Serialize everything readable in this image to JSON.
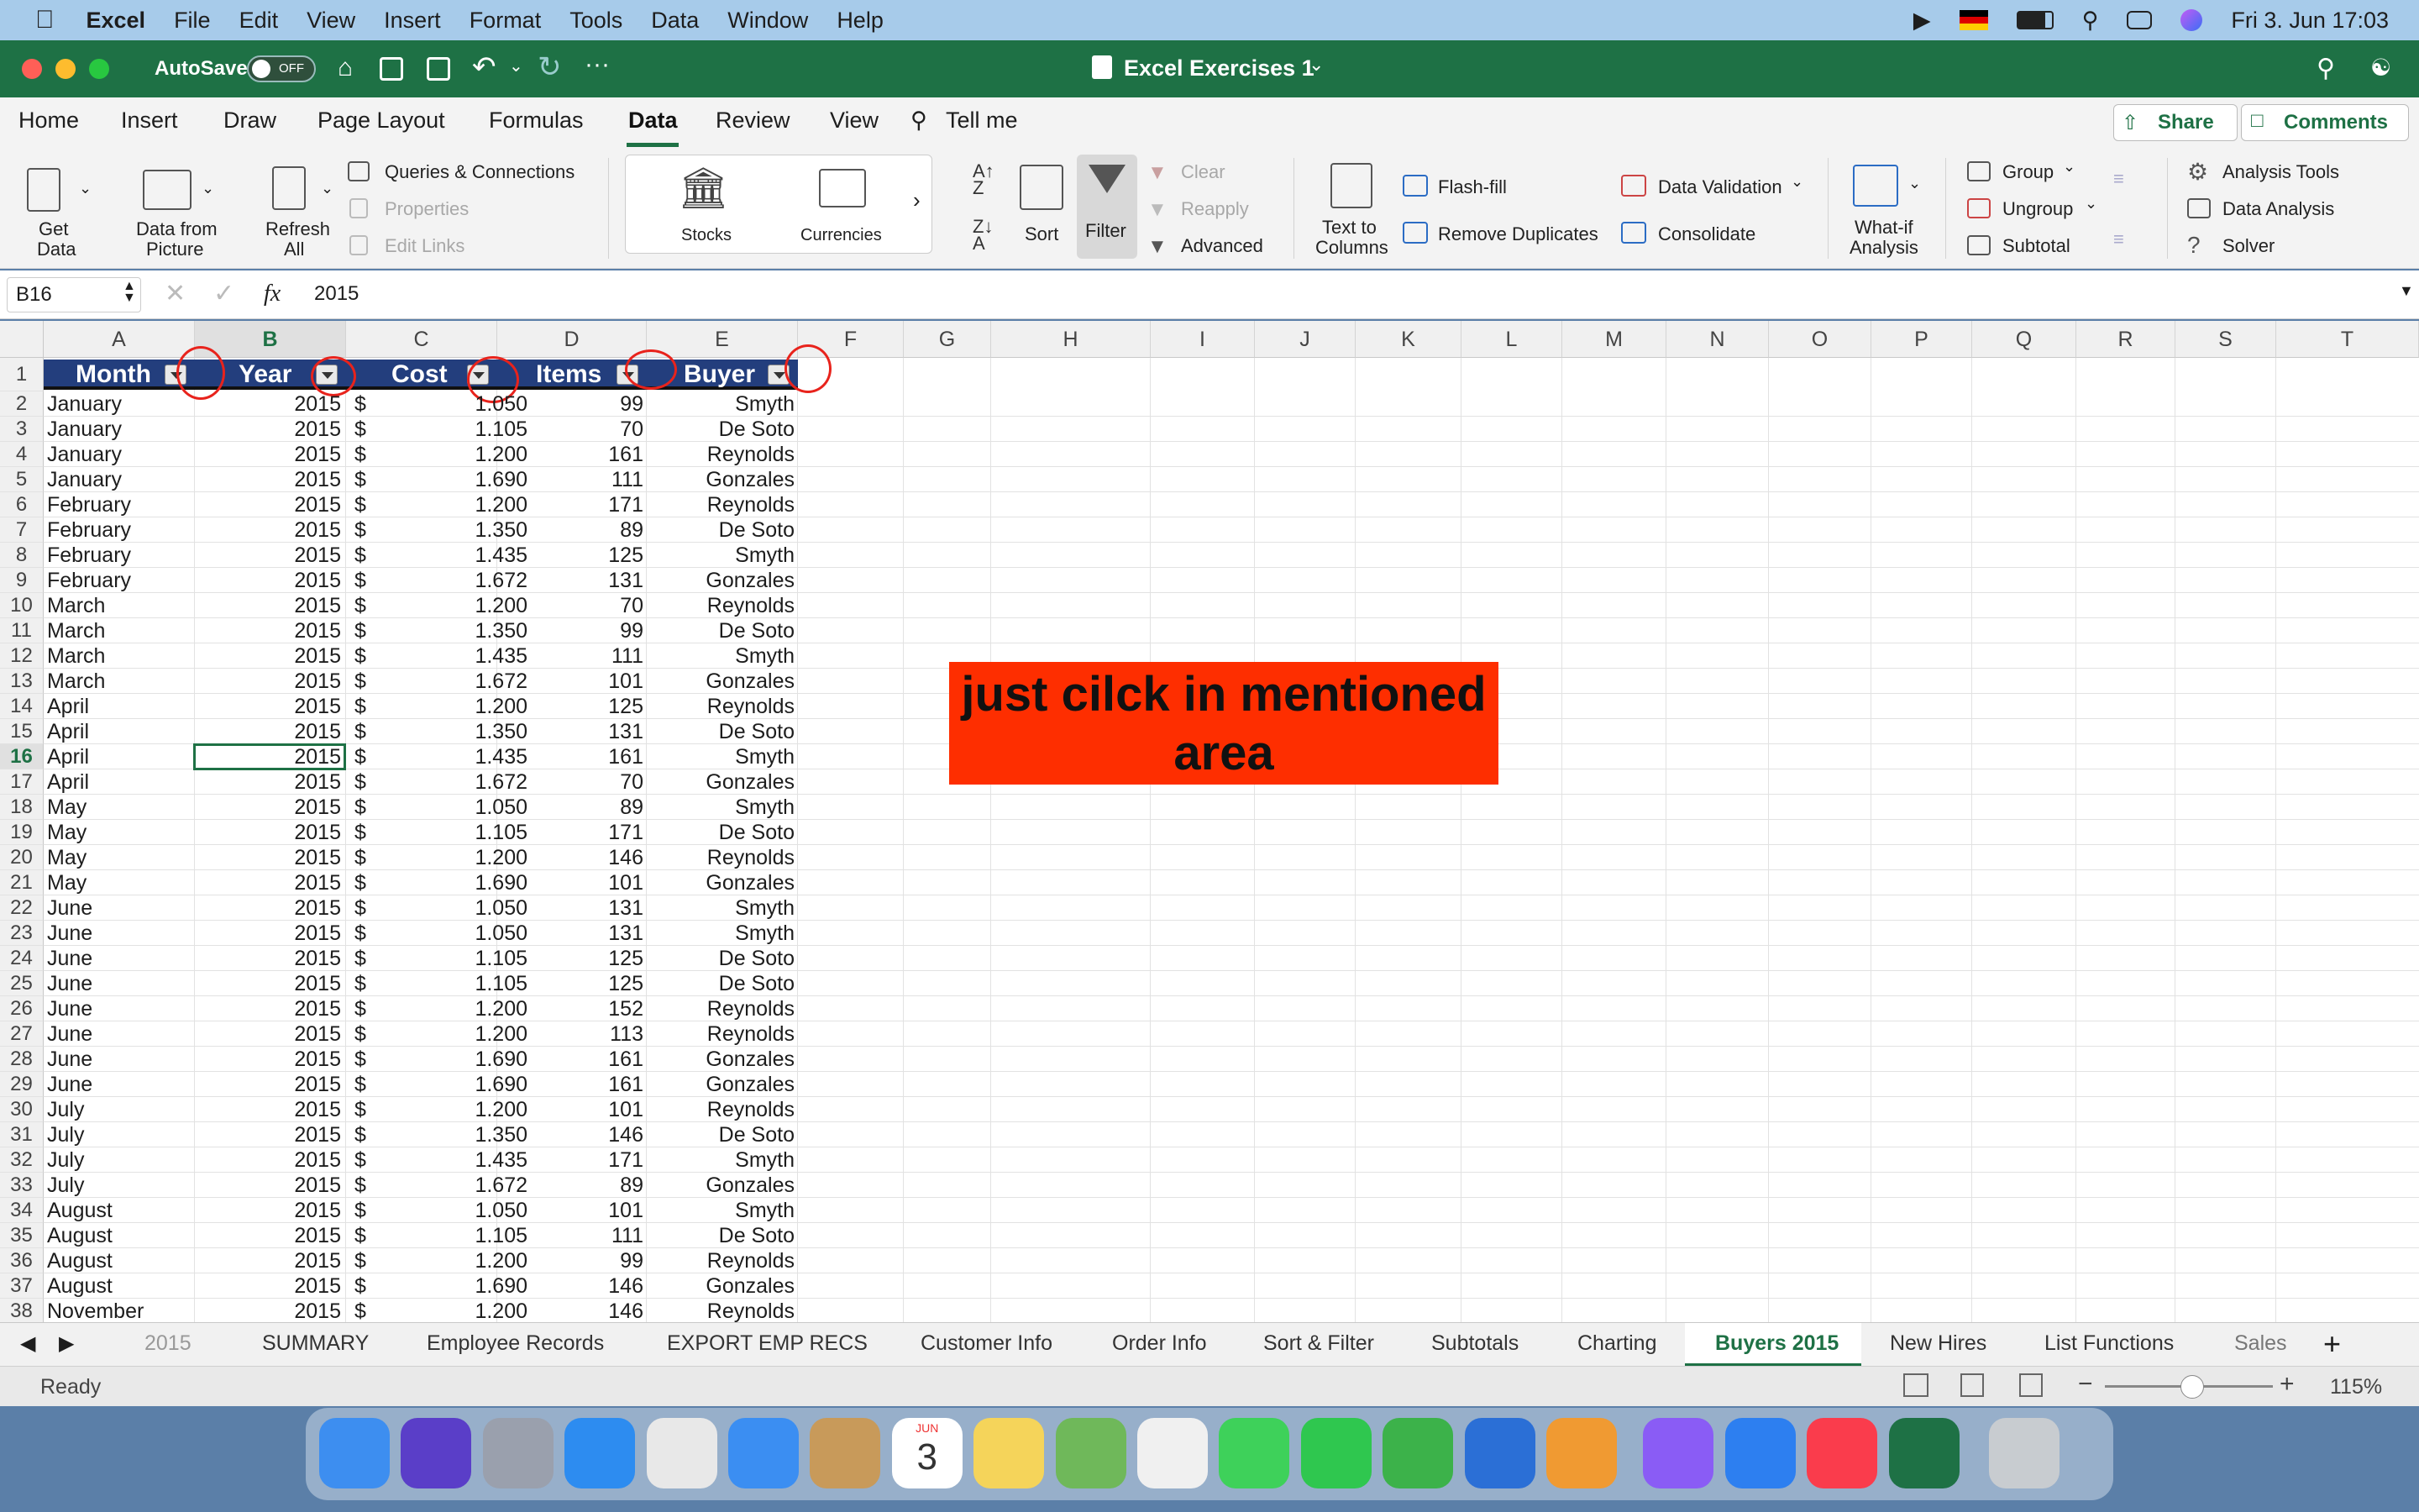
{
  "menubar": {
    "app": "Excel",
    "items": [
      "File",
      "Edit",
      "View",
      "Insert",
      "Format",
      "Tools",
      "Data",
      "Window",
      "Help"
    ],
    "clock": "Fri 3. Jun  17:03"
  },
  "titlebar": {
    "autosave": "AutoSave",
    "autosave_state": "OFF",
    "title": "Excel Exercises 1"
  },
  "ribbon_tabs": [
    "Home",
    "Insert",
    "Draw",
    "Page Layout",
    "Formulas",
    "Data",
    "Review",
    "View"
  ],
  "ribbon_active": "Data",
  "tell_me": "Tell me",
  "share": "Share",
  "comments": "Comments",
  "ribbon": {
    "get_data": [
      "Get",
      "Data"
    ],
    "data_from_picture": [
      "Data from",
      "Picture"
    ],
    "refresh_all": [
      "Refresh",
      "All"
    ],
    "queries": "Queries & Connections",
    "properties": "Properties",
    "edit_links": "Edit Links",
    "stocks": "Stocks",
    "currencies": "Currencies",
    "sort": "Sort",
    "filter": "Filter",
    "clear": "Clear",
    "reapply": "Reapply",
    "advanced": "Advanced",
    "text_to_columns": [
      "Text to",
      "Columns"
    ],
    "flash_fill": "Flash-fill",
    "remove_duplicates": "Remove Duplicates",
    "data_validation": "Data Validation",
    "consolidate": "Consolidate",
    "what_if": [
      "What-if",
      "Analysis"
    ],
    "group": "Group",
    "ungroup": "Ungroup",
    "subtotal": "Subtotal",
    "analysis_tools": "Analysis Tools",
    "data_analysis": "Data Analysis",
    "solver": "Solver"
  },
  "formula": {
    "name_box": "B16",
    "fx": "fx",
    "value": "2015"
  },
  "columns": [
    "A",
    "B",
    "C",
    "D",
    "E",
    "F",
    "G",
    "H",
    "I",
    "J",
    "K",
    "L",
    "M",
    "N",
    "O",
    "P",
    "Q",
    "R",
    "S",
    "T"
  ],
  "headers": [
    "Month",
    "Year",
    "Cost",
    "Items",
    "Buyer"
  ],
  "rows": [
    [
      "January",
      "2015",
      "$",
      "1.050",
      "99",
      "Smyth"
    ],
    [
      "January",
      "2015",
      "$",
      "1.105",
      "70",
      "De Soto"
    ],
    [
      "January",
      "2015",
      "$",
      "1.200",
      "161",
      "Reynolds"
    ],
    [
      "January",
      "2015",
      "$",
      "1.690",
      "111",
      "Gonzales"
    ],
    [
      "February",
      "2015",
      "$",
      "1.200",
      "171",
      "Reynolds"
    ],
    [
      "February",
      "2015",
      "$",
      "1.350",
      "89",
      "De Soto"
    ],
    [
      "February",
      "2015",
      "$",
      "1.435",
      "125",
      "Smyth"
    ],
    [
      "February",
      "2015",
      "$",
      "1.672",
      "131",
      "Gonzales"
    ],
    [
      "March",
      "2015",
      "$",
      "1.200",
      "70",
      "Reynolds"
    ],
    [
      "March",
      "2015",
      "$",
      "1.350",
      "99",
      "De Soto"
    ],
    [
      "March",
      "2015",
      "$",
      "1.435",
      "111",
      "Smyth"
    ],
    [
      "March",
      "2015",
      "$",
      "1.672",
      "101",
      "Gonzales"
    ],
    [
      "April",
      "2015",
      "$",
      "1.200",
      "125",
      "Reynolds"
    ],
    [
      "April",
      "2015",
      "$",
      "1.350",
      "131",
      "De Soto"
    ],
    [
      "April",
      "2015",
      "$",
      "1.435",
      "161",
      "Smyth"
    ],
    [
      "April",
      "2015",
      "$",
      "1.672",
      "70",
      "Gonzales"
    ],
    [
      "May",
      "2015",
      "$",
      "1.050",
      "89",
      "Smyth"
    ],
    [
      "May",
      "2015",
      "$",
      "1.105",
      "171",
      "De Soto"
    ],
    [
      "May",
      "2015",
      "$",
      "1.200",
      "146",
      "Reynolds"
    ],
    [
      "May",
      "2015",
      "$",
      "1.690",
      "101",
      "Gonzales"
    ],
    [
      "June",
      "2015",
      "$",
      "1.050",
      "131",
      "Smyth"
    ],
    [
      "June",
      "2015",
      "$",
      "1.050",
      "131",
      "Smyth"
    ],
    [
      "June",
      "2015",
      "$",
      "1.105",
      "125",
      "De Soto"
    ],
    [
      "June",
      "2015",
      "$",
      "1.105",
      "125",
      "De Soto"
    ],
    [
      "June",
      "2015",
      "$",
      "1.200",
      "152",
      "Reynolds"
    ],
    [
      "June",
      "2015",
      "$",
      "1.200",
      "113",
      "Reynolds"
    ],
    [
      "June",
      "2015",
      "$",
      "1.690",
      "161",
      "Gonzales"
    ],
    [
      "June",
      "2015",
      "$",
      "1.690",
      "161",
      "Gonzales"
    ],
    [
      "July",
      "2015",
      "$",
      "1.200",
      "101",
      "Reynolds"
    ],
    [
      "July",
      "2015",
      "$",
      "1.350",
      "146",
      "De Soto"
    ],
    [
      "July",
      "2015",
      "$",
      "1.435",
      "171",
      "Smyth"
    ],
    [
      "July",
      "2015",
      "$",
      "1.672",
      "89",
      "Gonzales"
    ],
    [
      "August",
      "2015",
      "$",
      "1.050",
      "101",
      "Smyth"
    ],
    [
      "August",
      "2015",
      "$",
      "1.105",
      "111",
      "De Soto"
    ],
    [
      "August",
      "2015",
      "$",
      "1.200",
      "99",
      "Reynolds"
    ],
    [
      "August",
      "2015",
      "$",
      "1.690",
      "146",
      "Gonzales"
    ],
    [
      "November",
      "2015",
      "$",
      "1.200",
      "146",
      "Reynolds"
    ]
  ],
  "selected_row": 16,
  "note": "just cilck in mentioned area",
  "sheet_tabs": [
    "2015",
    "SUMMARY",
    "Employee Records",
    "EXPORT EMP RECS",
    "Customer Info",
    "Order Info",
    "Sort & Filter",
    "Subtotals",
    "Charting",
    "Buyers 2015",
    "New Hires",
    "List Functions",
    "Sales"
  ],
  "active_sheet": "Buyers 2015",
  "status": {
    "text": "Ready",
    "zoom": "115%"
  },
  "dock": [
    "finder-icon",
    "siri-icon",
    "launchpad-icon",
    "safari-icon",
    "chrome-icon",
    "mail-icon",
    "contacts-icon",
    "calendar-icon",
    "notes-icon",
    "maps-icon",
    "photos-icon",
    "messages-icon",
    "facetime-icon",
    "numbers-icon",
    "keynote-icon",
    "pages-icon",
    "messenger-icon",
    "bluetooth-icon",
    "music-icon",
    "excel-icon",
    "trash-icon"
  ],
  "calendar": {
    "month": "JUN",
    "day": "3"
  }
}
